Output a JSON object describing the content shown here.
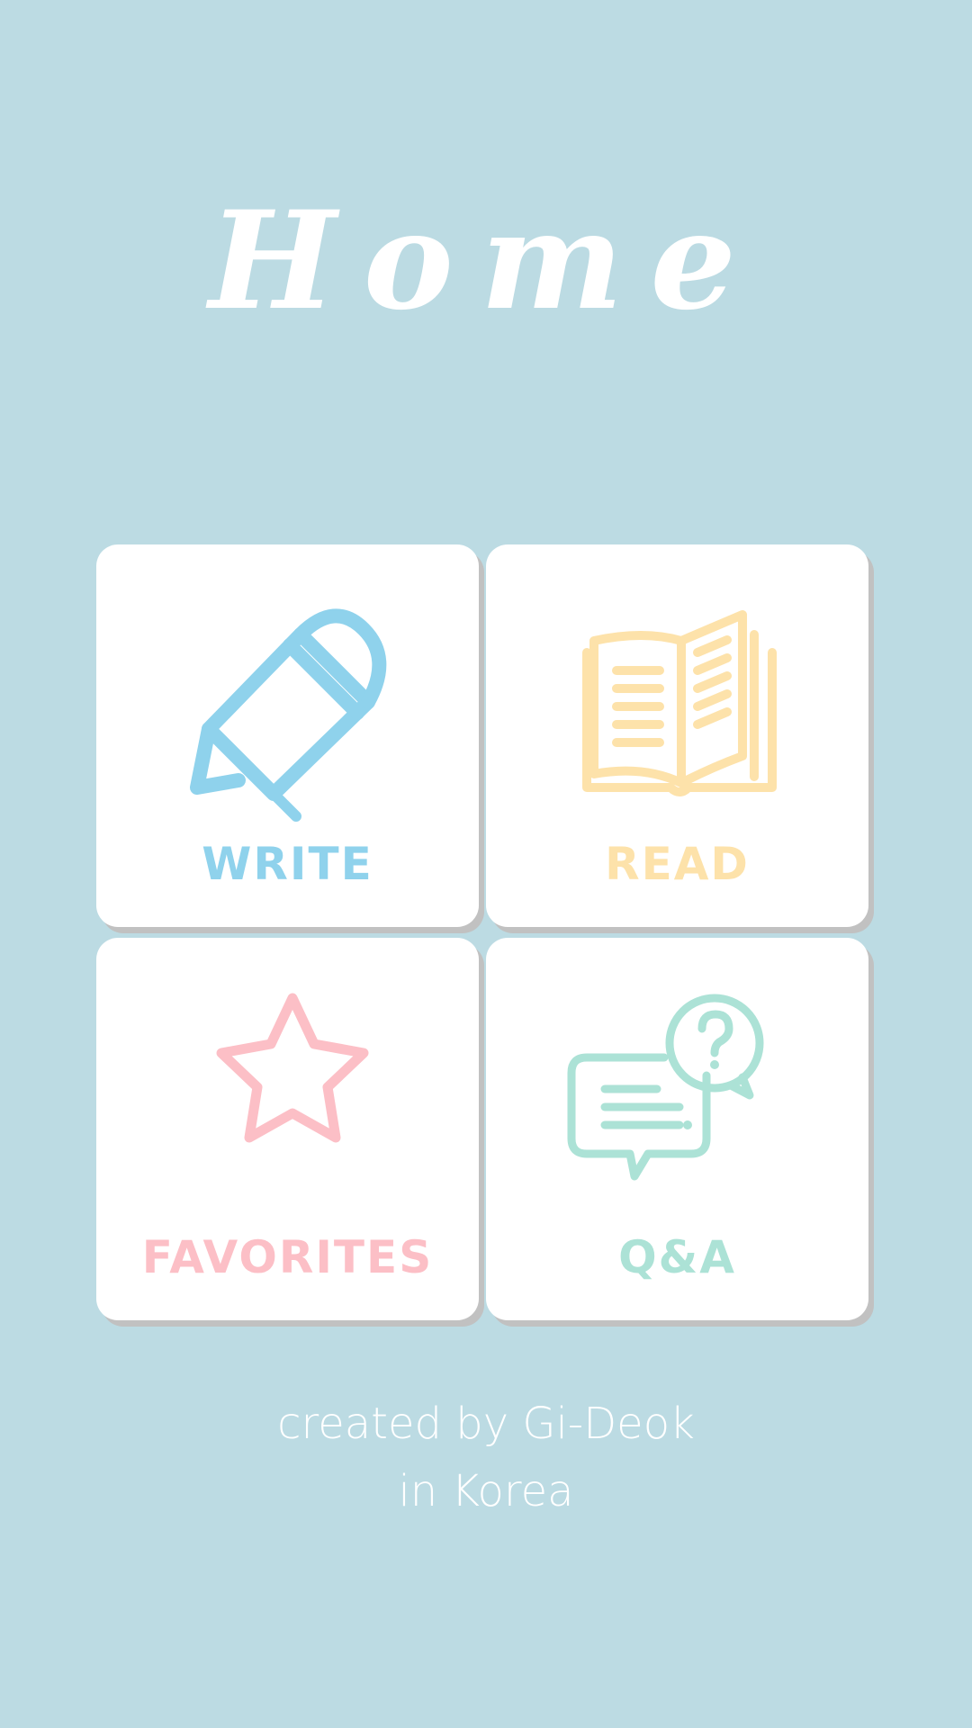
{
  "app": {
    "title": "Home"
  },
  "menu": {
    "write": {
      "label": "WRITE",
      "icon": "pencil-icon",
      "color": "#8fd2ec"
    },
    "read": {
      "label": "READ",
      "icon": "book-icon",
      "color": "#fde2aa"
    },
    "favorites": {
      "label": "FAVORITES",
      "icon": "star-icon",
      "color": "#fcbfc6"
    },
    "qa": {
      "label": "Q&A",
      "icon": "chat-question-icon",
      "color": "#ace2d6"
    }
  },
  "footer": {
    "line1": "created by Gi-Deok",
    "line2": "in Korea"
  },
  "colors": {
    "background": "#bcdbe3",
    "tile": "#ffffff",
    "shadow": "#c1c1c1"
  }
}
